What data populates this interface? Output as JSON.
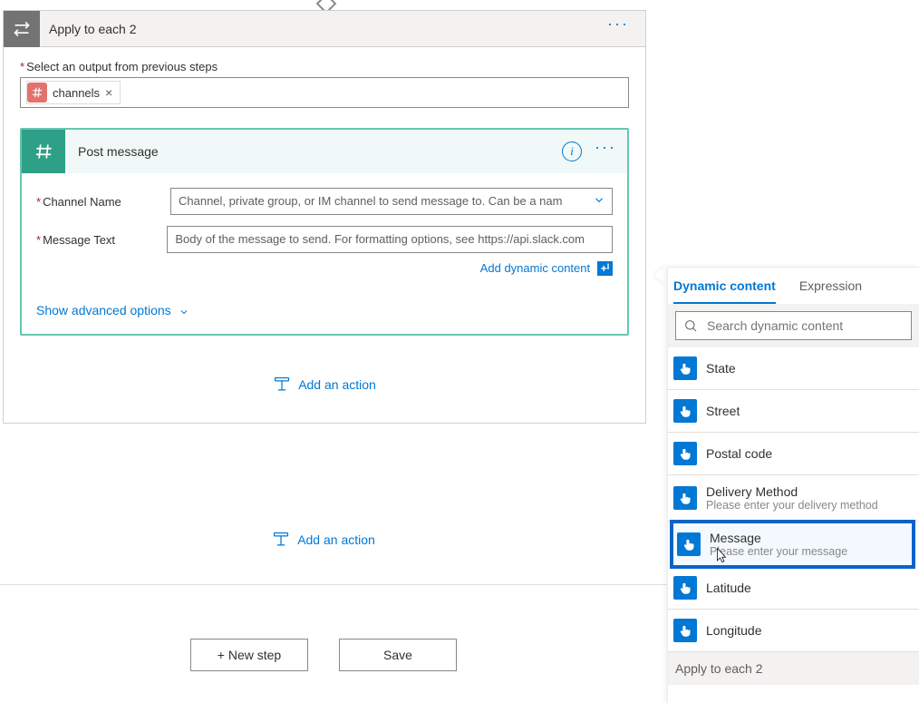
{
  "foreach": {
    "title": "Apply to each 2",
    "output_label": "Select an output from previous steps",
    "token_label": "channels"
  },
  "inner": {
    "title": "Post message",
    "channel_label": "Channel Name",
    "channel_placeholder": "Channel, private group, or IM channel to send message to. Can be a nam",
    "msg_label": "Message Text",
    "msg_placeholder": "Body of the message to send. For formatting options, see https://api.slack.com",
    "dyn_link": "Add dynamic content",
    "adv_link": "Show advanced options"
  },
  "actions": {
    "add_action": "Add an action",
    "new_step": "+ New step",
    "save": "Save"
  },
  "dyn_panel": {
    "tab1": "Dynamic content",
    "tab2": "Expression",
    "search_placeholder": "Search dynamic content",
    "items": [
      {
        "title": "State",
        "sub": ""
      },
      {
        "title": "Street",
        "sub": ""
      },
      {
        "title": "Postal code",
        "sub": ""
      },
      {
        "title": "Delivery Method",
        "sub": "Please enter your delivery method"
      },
      {
        "title": "Message",
        "sub": "Please enter your message"
      },
      {
        "title": "Latitude",
        "sub": ""
      },
      {
        "title": "Longitude",
        "sub": ""
      }
    ],
    "section": "Apply to each 2"
  }
}
